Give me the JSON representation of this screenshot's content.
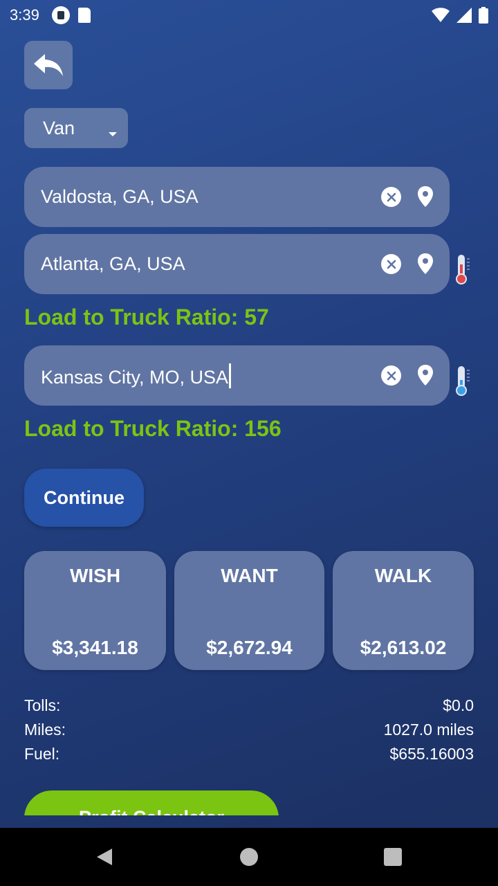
{
  "status_bar": {
    "time": "3:39"
  },
  "vehicle": {
    "selected": "Van"
  },
  "locations": [
    {
      "value": "Valdosta, GA, USA"
    },
    {
      "value": "Atlanta, GA, USA"
    },
    {
      "value": "Kansas City, MO, USA"
    }
  ],
  "ratios": [
    {
      "text": "Load to Truck Ratio: 57",
      "thermometer": "hot",
      "color": "#e0474c"
    },
    {
      "text": "Load to Truck Ratio: 156",
      "thermometer": "cold",
      "color": "#3aa0e8"
    }
  ],
  "continue_label": "Continue",
  "cards": [
    {
      "title": "WISH",
      "price": "$3,341.18"
    },
    {
      "title": "WANT",
      "price": "$2,672.94"
    },
    {
      "title": "WALK",
      "price": "$2,613.02"
    }
  ],
  "summary": [
    {
      "label": "Tolls:",
      "value": "$0.0"
    },
    {
      "label": "Miles:",
      "value": "1027.0 miles"
    },
    {
      "label": "Fuel:",
      "value": "$655.16003"
    }
  ],
  "profit_button_label": "Profit Calculator",
  "colors": {
    "accent_green": "#7cc412",
    "field_bg": "#6075a3",
    "button_blue": "#2652a8"
  }
}
